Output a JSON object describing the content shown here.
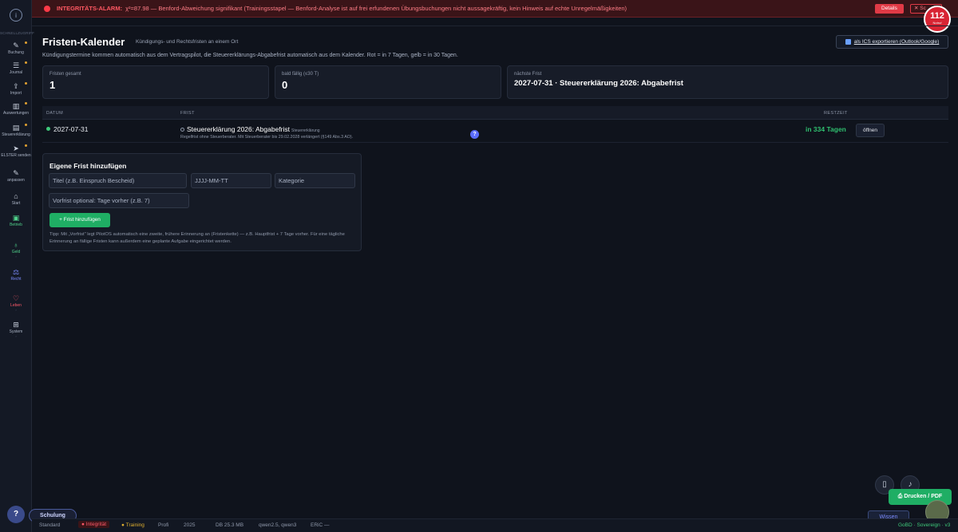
{
  "alarm": {
    "label": "INTEGRITÄTS-ALARM:",
    "message": "χ²=87.98 — Benford-Abweichung signifikant (Trainingsstapel — Benford-Analyse ist auf frei erfundenen Übungsbuchungen nicht aussagekräftig, kein Hinweis auf echte Unregelmäßigkeiten)",
    "details_label": "Details",
    "close_label": "✕ Sc"
  },
  "badge": {
    "number": "112",
    "sub": "Notruf"
  },
  "sidebar": {
    "header": "SCHNELLZUGRIFF",
    "items": [
      {
        "label": "Buchung",
        "icon": "pencil-icon"
      },
      {
        "label": "Journal",
        "icon": "list-icon"
      },
      {
        "label": "Import",
        "icon": "upload-icon"
      },
      {
        "label": "Auswertungen",
        "icon": "chart-icon"
      },
      {
        "label": "Steuererklärung",
        "icon": "document-icon"
      },
      {
        "label": "ELSTER senden",
        "icon": "send-icon"
      },
      {
        "label": "anpassen",
        "icon": "edit-icon"
      },
      {
        "label": "Start",
        "icon": "home-icon"
      },
      {
        "label": "Betrieb",
        "icon": "briefcase-icon"
      },
      {
        "label": "Geld",
        "icon": "piggy-bank-icon"
      },
      {
        "label": "Recht",
        "icon": "scale-icon"
      },
      {
        "label": "Leben",
        "icon": "heart-icon"
      },
      {
        "label": "System",
        "icon": "grid-icon"
      }
    ]
  },
  "page": {
    "title": "Fristen-Kalender",
    "subtitle": "Kündigungs- und Rechtsfristen an einem Ort",
    "description": "Kündigungstermine kommen automatisch aus dem Vertragspilot, die Steuererklärungs-Abgabefrist automatisch aus dem Kalender. Rot = in 7 Tagen, gelb = in 30 Tagen.",
    "export_label": "als ICS exportieren (Outlook/Google)"
  },
  "stats": [
    {
      "label": "Fristen gesamt",
      "value": "1"
    },
    {
      "label": "bald fällig (≤30 T)",
      "value": "0"
    },
    {
      "label": "nächste Frist",
      "value": "2027-07-31 · Steuererklärung 2026: Abgabefrist"
    }
  ],
  "table": {
    "headers": {
      "datum": "DATUM",
      "frist": "FRIST",
      "restzeit": "RESTZEIT"
    },
    "rows": [
      {
        "datum": "2027-07-31",
        "frist": "Steuererklärung 2026: Abgabefrist",
        "kategorie": "Steuererklärung",
        "note": "Regelfrist ohne Steuerberater. Mit Steuerberater bis 29.02.2028 verlängert (§149 Abs.3 AO).",
        "restzeit": "in 334 Tagen",
        "action": "öffnen",
        "status_color": "#3ec97a"
      }
    ]
  },
  "form": {
    "title": "Eigene Frist hinzufügen",
    "title_placeholder": "Titel (z.B. Einspruch Bescheid)",
    "date_placeholder": "JJJJ-MM-TT",
    "category_placeholder": "Kategorie",
    "vorfrist_placeholder": "Vorfrist optional: Tage vorher (z.B. 7)",
    "add_label": "+ Frist hinzufügen",
    "tip": "Tipp: Mit „Vorfrist\" legt PilotOS automatisch eine zweite, frühere Erinnerung an (Fristenkette) — z.B. Hauptfrist + 7 Tage vorher. Für eine tägliche Erinnerung an fällige Fristen kann außerdem eine geplante Aufgabe eingerichtet werden."
  },
  "floating": {
    "print_label": "Drucken / PDF",
    "wissen_label": "Wissen",
    "schulung_label": "Schulung",
    "help_label": "?"
  },
  "statusbar": {
    "standard": "Standard",
    "integritaet": "Integrität",
    "training": "Training",
    "profi": "Profi",
    "year": "2025",
    "db": "DB 25.3 MB",
    "models": "qwen2.5, qwen3",
    "eric": "ERiC —",
    "gobd": "GoBD · Sovereign · v3"
  },
  "colors": {
    "accent_green": "#1fae64",
    "alarm_red": "#e03a46",
    "accent_blue": "#5a6cff"
  }
}
